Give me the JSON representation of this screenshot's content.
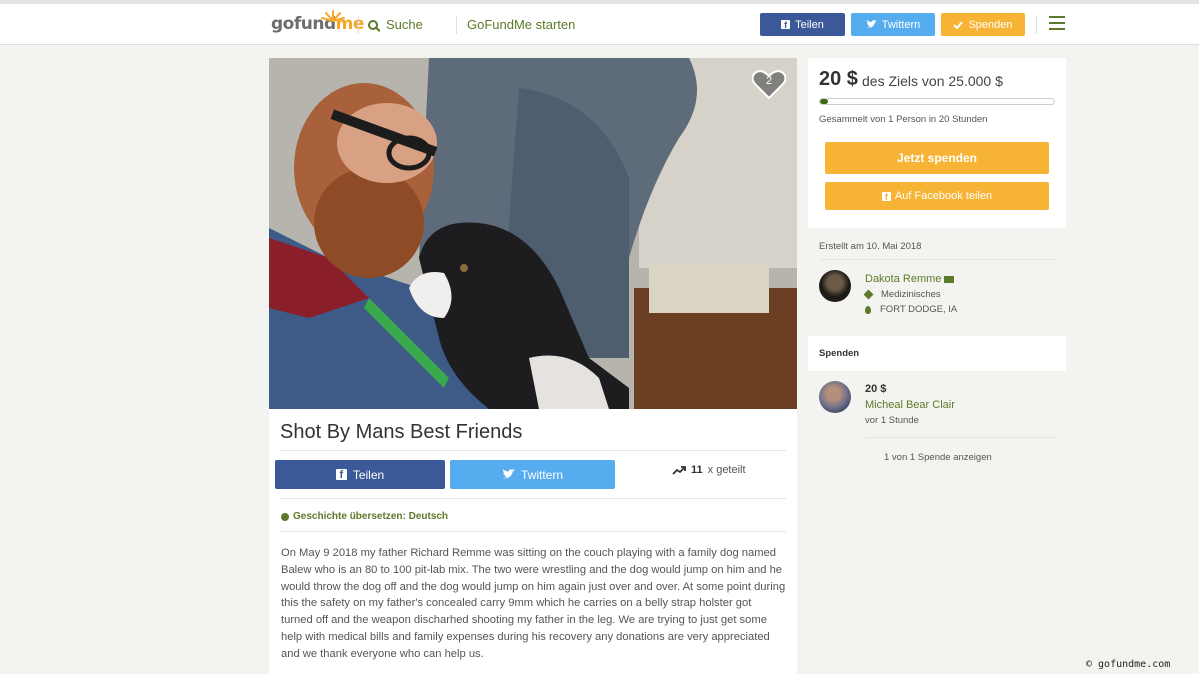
{
  "header": {
    "logo_fund": "gofund",
    "logo_me": "me",
    "search_label": "Suche",
    "start_label": "GoFundMe starten",
    "share_facebook": "Teilen",
    "share_twitter": "Twittern",
    "donate": "Spenden"
  },
  "campaign": {
    "hearts_count": "2",
    "title": "Shot By Mans Best Friends",
    "share_facebook": "Teilen",
    "share_twitter": "Twittern",
    "shares_count": "11",
    "shares_suffix": "x geteilt",
    "translate_link": "Geschichte übersetzen: Deutsch",
    "story": "On May 9 2018 my father Richard Remme was sitting on the couch playing with a family dog named Balew who is an 80 to 100 pit-lab mix. The two were wrestling and the dog would jump on him and he would throw the dog off and the dog would jump on him again just over and over. At some point during this the safety on my father's concealed carry 9mm which he carries on a belly strap holster got turned off and the weapon discharhed shooting my father in the leg. We are trying to just get some help with medical bills and family expenses during his recovery any donations are very appreciated and we thank everyone who can help us."
  },
  "goal": {
    "raised": "20 $",
    "goal_text": "des Ziels von 25.000 $",
    "progress_fraction": 0.0008,
    "collected_text": "Gesammelt von 1 Person in 20 Stunden",
    "donate_button": "Jetzt spenden",
    "facebook_share_button": "Auf Facebook teilen"
  },
  "organizer": {
    "created_text": "Erstellt am 10. Mai 2018",
    "name": "Dakota Remme",
    "category": "Medizinisches",
    "location": "FORT DODGE, IA"
  },
  "donations": {
    "heading": "Spenden",
    "items": [
      {
        "amount": "20 $",
        "name": "Micheal Bear Clair",
        "time": "vor 1 Stunde"
      }
    ],
    "show_all": "1 von 1 Spende anzeigen"
  },
  "credit": "© gofundme.com",
  "colors": {
    "brand_green": "#5c7a2a",
    "facebook_blue": "#3b5998",
    "twitter_blue": "#55acee",
    "donate_orange": "#f7b334",
    "progress_green": "#3b6b10"
  }
}
